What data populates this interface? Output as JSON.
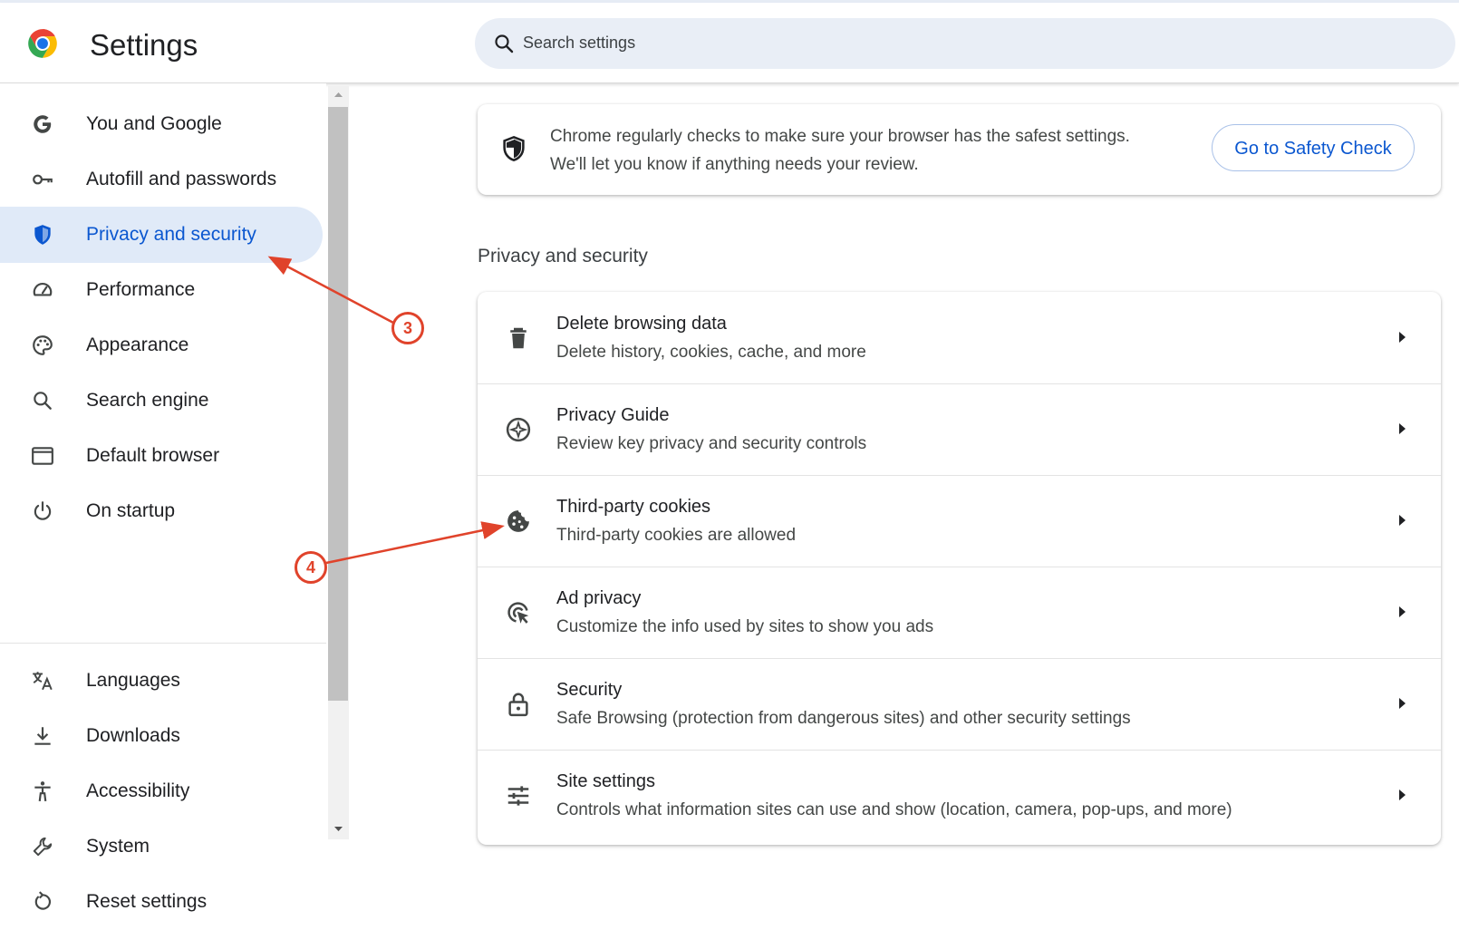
{
  "header": {
    "title": "Settings",
    "search_placeholder": "Search settings"
  },
  "sidebar": {
    "items": [
      {
        "label": "You and Google",
        "icon": "google-g-icon"
      },
      {
        "label": "Autofill and passwords",
        "icon": "key-icon"
      },
      {
        "label": "Privacy and security",
        "icon": "shield-icon",
        "active": true
      },
      {
        "label": "Performance",
        "icon": "speedometer-icon"
      },
      {
        "label": "Appearance",
        "icon": "palette-icon"
      },
      {
        "label": "Search engine",
        "icon": "search-icon"
      },
      {
        "label": "Default browser",
        "icon": "browser-window-icon"
      },
      {
        "label": "On startup",
        "icon": "power-icon"
      },
      {
        "label": "Languages",
        "icon": "translate-icon"
      },
      {
        "label": "Downloads",
        "icon": "download-icon"
      },
      {
        "label": "Accessibility",
        "icon": "accessibility-icon"
      },
      {
        "label": "System",
        "icon": "wrench-icon"
      },
      {
        "label": "Reset settings",
        "icon": "reset-icon"
      }
    ]
  },
  "safety_check": {
    "line1": "Chrome regularly checks to make sure your browser has the safest settings.",
    "line2": "We'll let you know if anything needs your review.",
    "button": "Go to Safety Check"
  },
  "section": {
    "title": "Privacy and security",
    "rows": [
      {
        "title": "Delete browsing data",
        "subtitle": "Delete history, cookies, cache, and more",
        "icon": "trash-icon"
      },
      {
        "title": "Privacy Guide",
        "subtitle": "Review key privacy and security controls",
        "icon": "compass-icon"
      },
      {
        "title": "Third-party cookies",
        "subtitle": "Third-party cookies are allowed",
        "icon": "cookie-icon"
      },
      {
        "title": "Ad privacy",
        "subtitle": "Customize the info used by sites to show you ads",
        "icon": "ad-privacy-icon"
      },
      {
        "title": "Security",
        "subtitle": "Safe Browsing (protection from dangerous sites) and other security settings",
        "icon": "lock-icon"
      },
      {
        "title": "Site settings",
        "subtitle": "Controls what information sites can use and show (location, camera, pop-ups, and more)",
        "icon": "sliders-icon"
      }
    ]
  },
  "annotations": {
    "step3": "3",
    "step4": "4"
  },
  "colors": {
    "accent": "#0b57d0",
    "active_bg": "#e0eaf8",
    "annotation": "#e0432b"
  }
}
